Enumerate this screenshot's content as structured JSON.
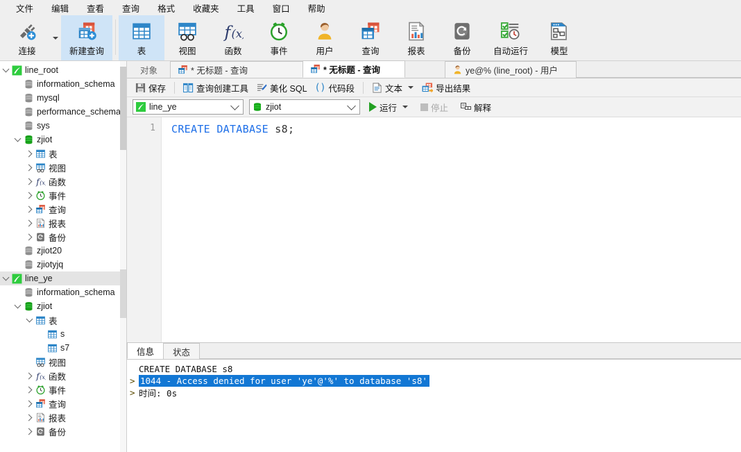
{
  "menubar": {
    "items": [
      {
        "label": "文件",
        "name": "menu-file"
      },
      {
        "label": "编辑",
        "name": "menu-edit"
      },
      {
        "label": "查看",
        "name": "menu-view"
      },
      {
        "label": "查询",
        "name": "menu-query"
      },
      {
        "label": "格式",
        "name": "menu-format"
      },
      {
        "label": "收藏夹",
        "name": "menu-favorites"
      },
      {
        "label": "工具",
        "name": "menu-tools"
      },
      {
        "label": "窗口",
        "name": "menu-window"
      },
      {
        "label": "帮助",
        "name": "menu-help"
      }
    ]
  },
  "ribbon": {
    "buttons": [
      {
        "label": "连接",
        "icon": "connection-icon",
        "active": false
      },
      {
        "label": "新建查询",
        "icon": "new-query-icon",
        "active": true
      },
      {
        "label": "表",
        "icon": "table-icon",
        "active": true
      },
      {
        "label": "视图",
        "icon": "view-icon",
        "active": false
      },
      {
        "label": "函数",
        "icon": "function-icon",
        "active": false
      },
      {
        "label": "事件",
        "icon": "event-clock-icon",
        "active": false
      },
      {
        "label": "用户",
        "icon": "user-icon",
        "active": false
      },
      {
        "label": "查询",
        "icon": "query-icon",
        "active": false
      },
      {
        "label": "报表",
        "icon": "report-icon",
        "active": false
      },
      {
        "label": "备份",
        "icon": "backup-icon",
        "active": false
      },
      {
        "label": "自动运行",
        "icon": "automation-icon",
        "active": false
      },
      {
        "label": "模型",
        "icon": "model-icon",
        "active": false
      }
    ]
  },
  "sidebar": {
    "tree": [
      {
        "label": "line_root",
        "icon": "connection-green-icon",
        "indent": 0,
        "toggle": "down",
        "selected": false
      },
      {
        "label": "information_schema",
        "icon": "database-gray-icon",
        "indent": 1,
        "toggle": "none",
        "selected": false
      },
      {
        "label": "mysql",
        "icon": "database-gray-icon",
        "indent": 1,
        "toggle": "none",
        "selected": false
      },
      {
        "label": "performance_schema",
        "icon": "database-gray-icon",
        "indent": 1,
        "toggle": "none",
        "selected": false
      },
      {
        "label": "sys",
        "icon": "database-gray-icon",
        "indent": 1,
        "toggle": "none",
        "selected": false
      },
      {
        "label": "zjiot",
        "icon": "database-green-icon",
        "indent": 1,
        "toggle": "down",
        "selected": false
      },
      {
        "label": "表",
        "icon": "table-icon",
        "indent": 2,
        "toggle": "right",
        "selected": false
      },
      {
        "label": "视图",
        "icon": "view-icon",
        "indent": 2,
        "toggle": "right",
        "selected": false
      },
      {
        "label": "函数",
        "icon": "function-icon",
        "indent": 2,
        "toggle": "right",
        "selected": false
      },
      {
        "label": "事件",
        "icon": "event-clock-icon",
        "indent": 2,
        "toggle": "right",
        "selected": false
      },
      {
        "label": "查询",
        "icon": "query-icon",
        "indent": 2,
        "toggle": "right",
        "selected": false
      },
      {
        "label": "报表",
        "icon": "report-icon",
        "indent": 2,
        "toggle": "right",
        "selected": false
      },
      {
        "label": "备份",
        "icon": "backup-icon",
        "indent": 2,
        "toggle": "right",
        "selected": false
      },
      {
        "label": "zjiot20",
        "icon": "database-gray-icon",
        "indent": 1,
        "toggle": "none",
        "selected": false
      },
      {
        "label": "zjiotyjq",
        "icon": "database-gray-icon",
        "indent": 1,
        "toggle": "none",
        "selected": false
      },
      {
        "label": "line_ye",
        "icon": "connection-green-icon",
        "indent": 0,
        "toggle": "down",
        "selected": true
      },
      {
        "label": "information_schema",
        "icon": "database-gray-icon",
        "indent": 1,
        "toggle": "none",
        "selected": false
      },
      {
        "label": "zjiot",
        "icon": "database-green-icon",
        "indent": 1,
        "toggle": "down",
        "selected": false
      },
      {
        "label": "表",
        "icon": "table-icon",
        "indent": 2,
        "toggle": "down",
        "selected": false
      },
      {
        "label": "s",
        "icon": "table-icon",
        "indent": 3,
        "toggle": "none",
        "selected": false
      },
      {
        "label": "s7",
        "icon": "table-icon",
        "indent": 3,
        "toggle": "none",
        "selected": false
      },
      {
        "label": "视图",
        "icon": "view-icon",
        "indent": 2,
        "toggle": "none",
        "selected": false
      },
      {
        "label": "函数",
        "icon": "function-icon",
        "indent": 2,
        "toggle": "right",
        "selected": false
      },
      {
        "label": "事件",
        "icon": "event-clock-icon",
        "indent": 2,
        "toggle": "right",
        "selected": false
      },
      {
        "label": "查询",
        "icon": "query-icon",
        "indent": 2,
        "toggle": "right",
        "selected": false
      },
      {
        "label": "报表",
        "icon": "report-icon",
        "indent": 2,
        "toggle": "right",
        "selected": false
      },
      {
        "label": "备份",
        "icon": "backup-icon",
        "indent": 2,
        "toggle": "right",
        "selected": false
      }
    ]
  },
  "tabs": {
    "object_label": "对象",
    "items": [
      {
        "label": "* 无标题 - 查询",
        "icon": "query-icon",
        "active": false
      },
      {
        "label": "* 无标题 - 查询",
        "icon": "query-icon",
        "active": true
      },
      {
        "label": "ye@% (line_root) - 用户",
        "icon": "user-icon",
        "active": false
      }
    ]
  },
  "query_toolbar": {
    "buttons": [
      {
        "label": "保存",
        "icon": "save-icon"
      },
      {
        "label": "查询创建工具",
        "icon": "query-builder-icon"
      },
      {
        "label": "美化 SQL",
        "icon": "beautify-sql-icon"
      },
      {
        "label": "代码段",
        "icon": "code-snippet-icon"
      },
      {
        "label": "文本",
        "icon": "text-icon",
        "caret": true
      },
      {
        "label": "导出结果",
        "icon": "export-result-icon"
      }
    ]
  },
  "connbar": {
    "connection": "line_ye",
    "database": "zjiot",
    "run_label": "运行",
    "stop_label": "停止",
    "explain_label": "解释"
  },
  "editor": {
    "line_number": "1",
    "keyword": "CREATE DATABASE",
    "rest": " s8;"
  },
  "bottom_panel": {
    "tabs": [
      {
        "label": "信息",
        "active": true
      },
      {
        "label": "状态",
        "active": false
      }
    ],
    "log": [
      {
        "prefix": "",
        "text": "CREATE DATABASE s8",
        "highlight": false
      },
      {
        "prefix": ">",
        "text": "1044 - Access denied for user 'ye'@'%' to database 's8'",
        "highlight": true
      },
      {
        "prefix": ">",
        "text": "时间: 0s",
        "highlight": false
      }
    ]
  },
  "colors": {
    "accent_blue": "#1277d4",
    "ribbon_bg": "#efefef",
    "active_btn": "#cfe4f7",
    "keyword": "#1e6fe8",
    "green": "#22a022"
  }
}
